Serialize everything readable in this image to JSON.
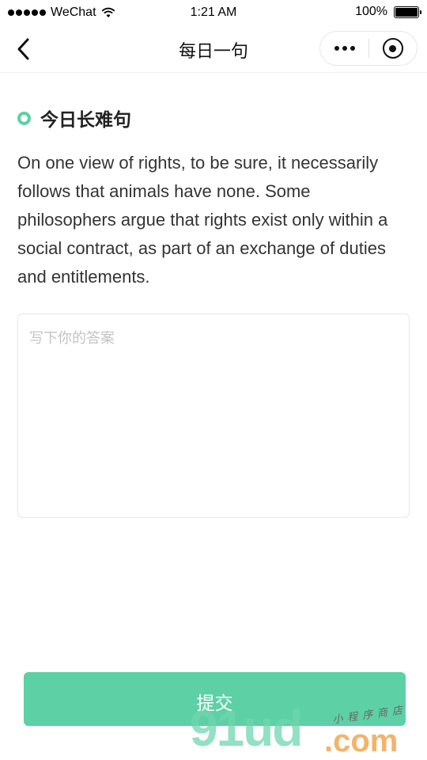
{
  "status_bar": {
    "carrier": "WeChat",
    "time": "1:21 AM",
    "battery_percent": "100%",
    "battery_level": 1.0
  },
  "nav": {
    "title": "每日一句",
    "back_icon": "chevron-left-icon",
    "more_icon": "more-dots-icon",
    "close_icon": "target-icon"
  },
  "section": {
    "title": "今日长难句",
    "icon": "circle-outline-icon",
    "accent_color": "#5dd0a6"
  },
  "sentence": {
    "text": "On one view of rights, to be sure, it necessarily follows that animals have none. Some philosophers argue that rights exist only within a social contract, as part of an exchange of duties and entitlements."
  },
  "answer": {
    "placeholder": "写下你的答案",
    "value": ""
  },
  "submit": {
    "label": "提交",
    "color": "#5dd0a6"
  },
  "watermark": {
    "main": "91ud",
    "suffix": ".com",
    "script": "小程序商店"
  }
}
